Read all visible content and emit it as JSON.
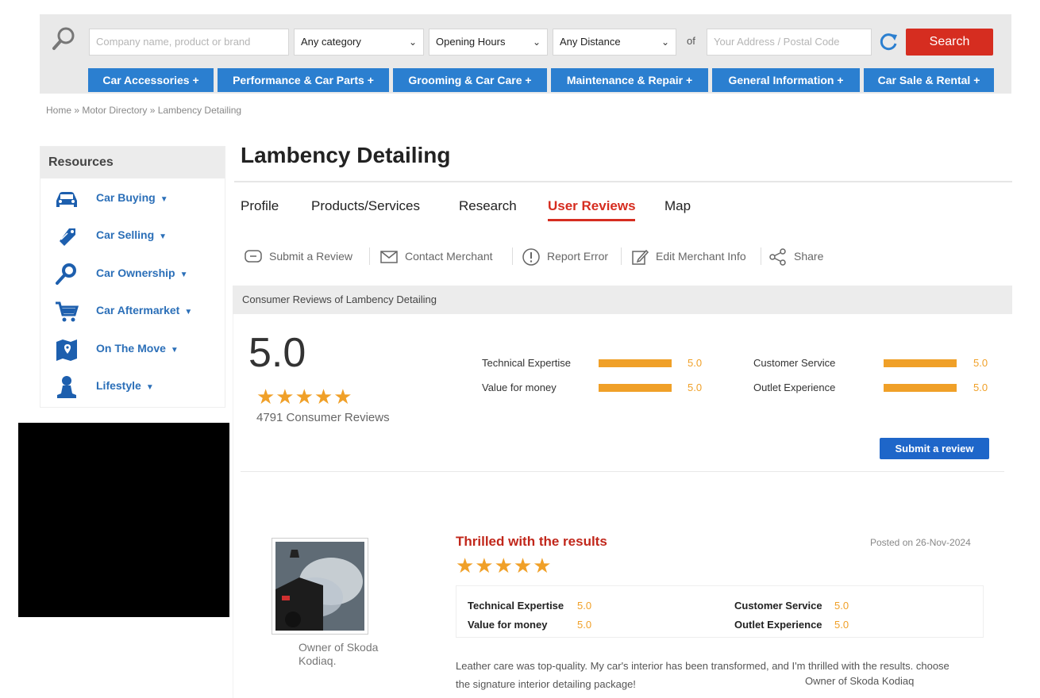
{
  "search": {
    "keyword_placeholder": "Company name, product or brand",
    "category_value": "Any category",
    "hours_value": "Opening Hours",
    "distance_value": "Any Distance",
    "of_label": "of",
    "address_placeholder": "Your Address / Postal Code",
    "search_label": "Search"
  },
  "categories": [
    "Car Accessories +",
    "Performance & Car Parts +",
    "Grooming & Car Care +",
    "Maintenance & Repair +",
    "General Information +",
    "Car Sale & Rental +"
  ],
  "breadcrumb": "Home » Motor Directory » Lambency Detailing",
  "sidebar": {
    "title": "Resources",
    "items": [
      {
        "label": "Car Buying",
        "icon": "car-icon"
      },
      {
        "label": "Car Selling",
        "icon": "tag-icon"
      },
      {
        "label": "Car Ownership",
        "icon": "key-icon"
      },
      {
        "label": "Car Aftermarket",
        "icon": "cart-icon"
      },
      {
        "label": "On The Move",
        "icon": "map-icon"
      },
      {
        "label": "Lifestyle",
        "icon": "person-icon"
      }
    ]
  },
  "merchant": {
    "name": "Lambency Detailing"
  },
  "tabs": [
    "Profile",
    "Products/Services",
    "Research",
    "User Reviews",
    "Map"
  ],
  "actions": [
    "Submit a Review",
    "Contact Merchant",
    "Report Error",
    "Edit Merchant Info",
    "Share"
  ],
  "reviews": {
    "header": "Consumer Reviews of Lambency Detailing",
    "overall": "5.0",
    "stars": "★★★★★",
    "count": "4791 Consumer Reviews",
    "metrics": [
      {
        "label": "Technical Expertise",
        "value": "5.0",
        "fill": 1.0
      },
      {
        "label": "Customer Service",
        "value": "5.0",
        "fill": 1.0
      },
      {
        "label": "Value for money",
        "value": "5.0",
        "fill": 1.0
      },
      {
        "label": "Outlet Experience",
        "value": "5.0",
        "fill": 1.0
      }
    ],
    "submit_label": "Submit a review"
  },
  "review": {
    "title": "Thrilled with the results",
    "date": "Posted on 26-Nov-2024",
    "stars": "★★★★★",
    "owner": "Owner of Skoda Kodiaq.",
    "metrics": [
      {
        "label": "Technical Expertise",
        "value": "5.0"
      },
      {
        "label": "Customer Service",
        "value": "5.0"
      },
      {
        "label": "Value for money",
        "value": "5.0"
      },
      {
        "label": "Outlet Experience",
        "value": "5.0"
      }
    ],
    "body": "Leather care was top-quality. My car's interior has been transformed, and I'm thrilled with the results. choose the signature interior detailing package!",
    "signature": "Owner of Skoda Kodiaq"
  },
  "colors": {
    "accent_red": "#d62d20",
    "tab_blue": "#2b7fd0",
    "star_orange": "#f0a028",
    "link_blue": "#2b6fb8"
  }
}
